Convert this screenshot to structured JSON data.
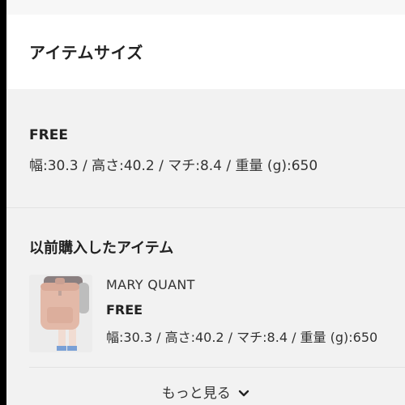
{
  "header": {
    "title": "アイテムサイズ"
  },
  "size": {
    "label": "FREE",
    "detail": "幅:30.3 / 高さ:40.2 / マチ:8.4 / 重量 (g):650"
  },
  "previous": {
    "title": "以前購入したアイテム",
    "items": [
      {
        "brand": "MARY QUANT",
        "size": "FREE",
        "detail": "幅:30.3 / 高さ:40.2 / マチ:8.4 / 重量 (g):650"
      }
    ],
    "more_label": "もっと見る"
  },
  "colors": {
    "background": "#f2f2f2",
    "header_bg": "#ffffff",
    "bag": "#e3b9a8"
  },
  "icons": {
    "more": "chevron-down-icon"
  }
}
